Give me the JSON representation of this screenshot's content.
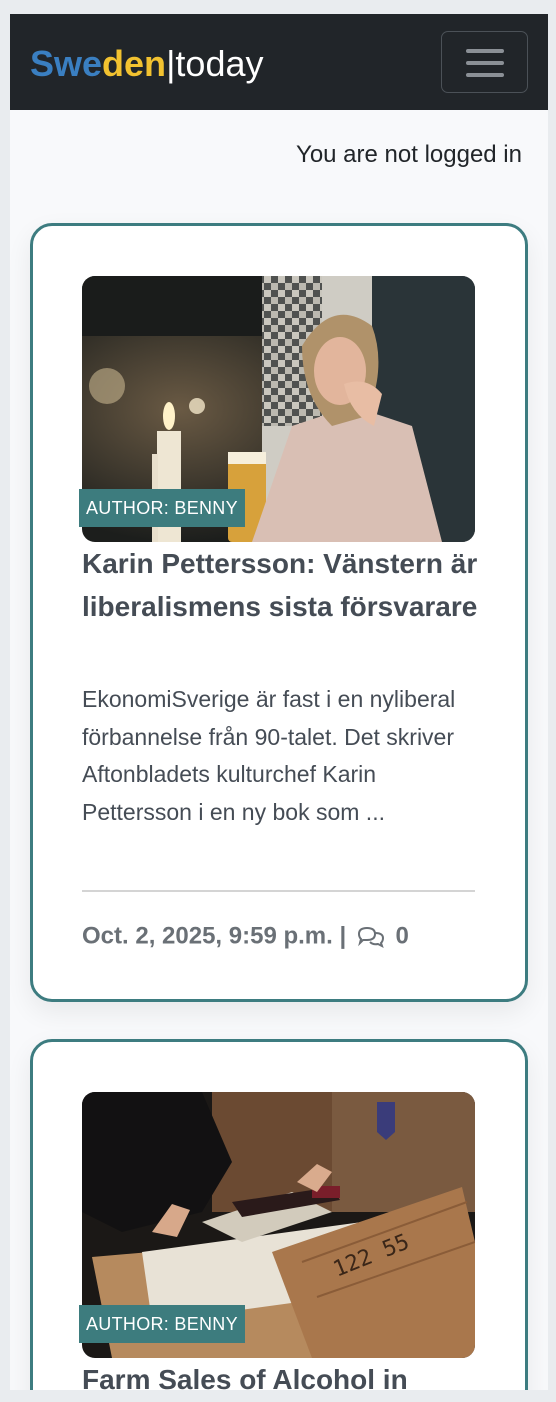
{
  "navbar": {
    "brand_part1": "Swe",
    "brand_part2": "den",
    "brand_part3": "|today",
    "menu_icon": "hamburger-menu-icon",
    "brand_colors": {
      "swe": "#3a7fc1",
      "den": "#f2c230",
      "today": "#ffffff"
    },
    "background": "#212529"
  },
  "auth": {
    "status_text": "You are not logged in"
  },
  "accent_color": "#3d7c80",
  "articles": [
    {
      "author_badge": "AUTHOR: BENNY",
      "title": "Karin Pettersson: Vänstern är liberalismens sista försvarare",
      "excerpt": "EkonomiSverige är fast i en nyliberal förbannelse från 90-talet. Det skriver Aftonbladets kulturchef Karin Pettersson i en ny bok som ...",
      "date": "Oct. 2, 2025, 9:59 p.m.",
      "separator": "|",
      "comment_icon": "comments-icon",
      "comment_count": "0"
    },
    {
      "author_badge": "AUTHOR: BENNY",
      "title": "Farm Sales of Alcohol in"
    }
  ]
}
